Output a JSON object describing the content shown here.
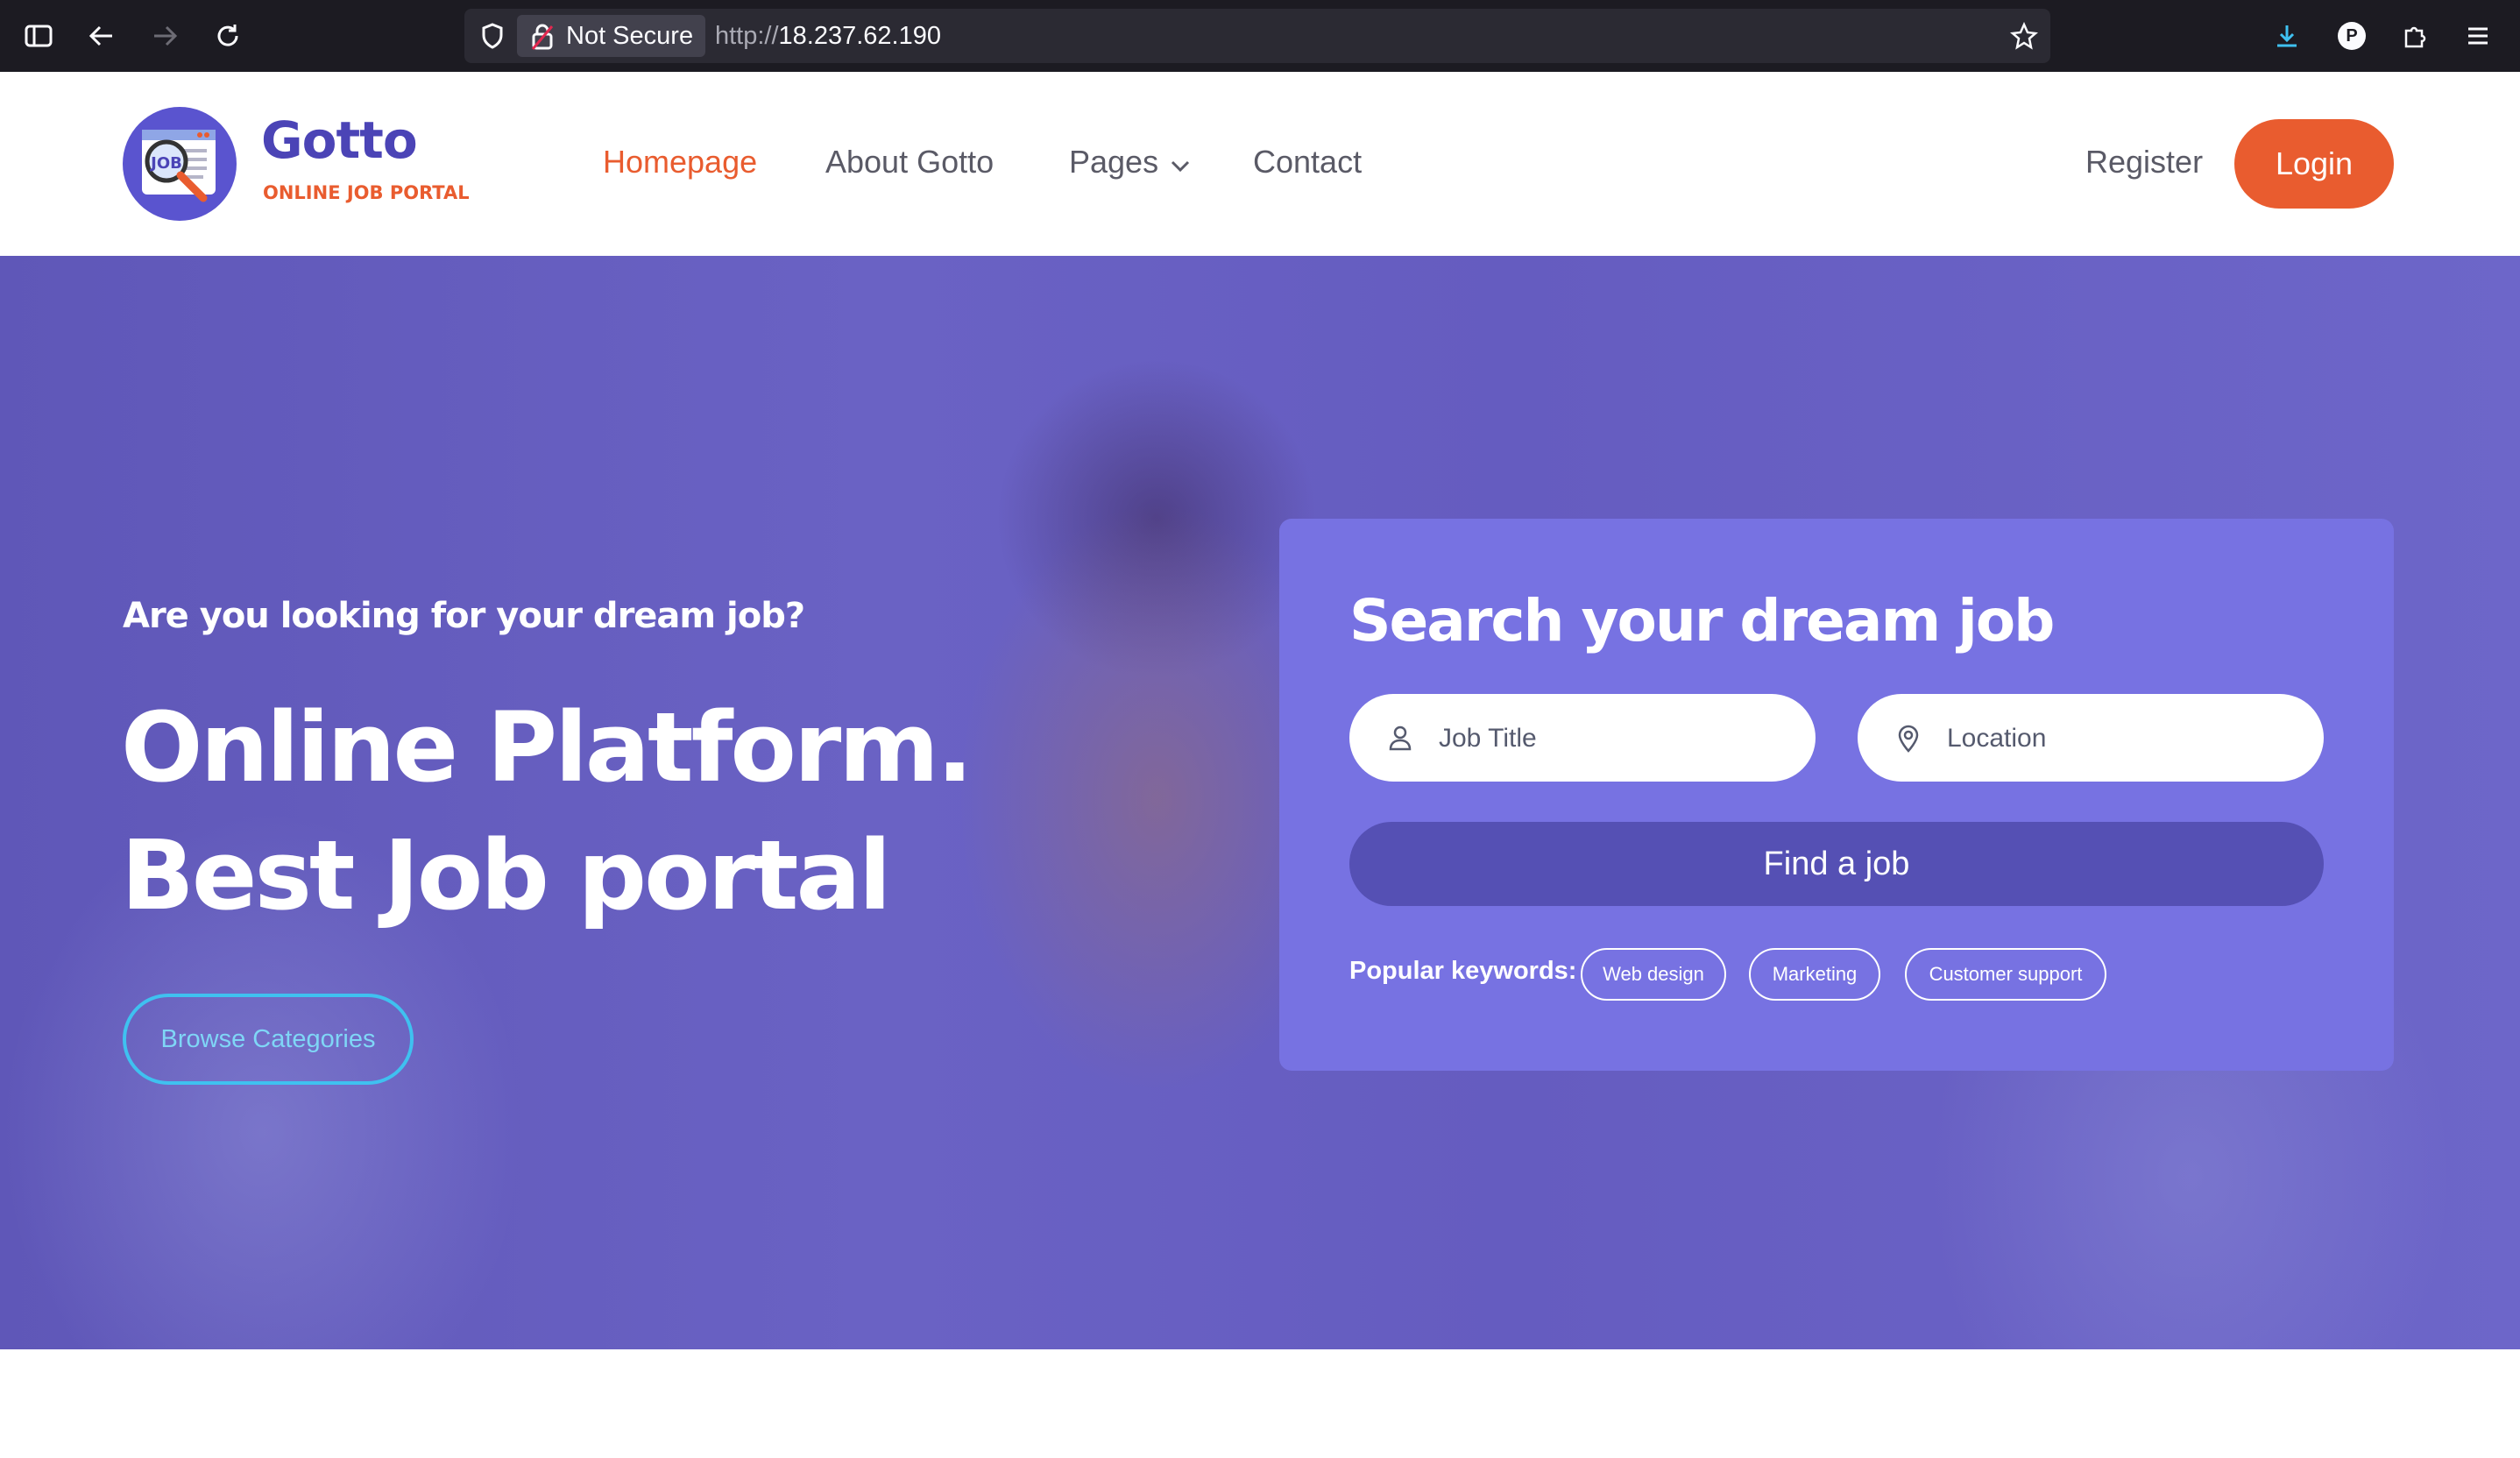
{
  "browser": {
    "security_label": "Not Secure",
    "url_protocol": "http://",
    "url_host": "18.237.62.190",
    "profile_initial": "P"
  },
  "header": {
    "brand_name": "Gotto",
    "brand_tagline": "ONLINE JOB PORTAL",
    "logo_text": "JOB",
    "nav": [
      {
        "label": "Homepage",
        "active": true
      },
      {
        "label": "About Gotto"
      },
      {
        "label": "Pages"
      },
      {
        "label": "Contact"
      }
    ],
    "register_label": "Register",
    "login_label": "Login"
  },
  "hero": {
    "subtitle": "Are you looking for your dream job?",
    "title_line1": "Online Platform.",
    "title_line2": "Best Job portal",
    "browse_label": "Browse Categories"
  },
  "search": {
    "title": "Search your dream job",
    "job_title_placeholder": "Job Title",
    "location_placeholder": "Location",
    "submit_label": "Find a job",
    "keywords_label": "Popular keywords:",
    "keywords": [
      "Web design",
      "Marketing",
      "Customer support"
    ]
  },
  "colors": {
    "accent": "#e95c2f",
    "brand": "#4b44b6",
    "panel": "#7772e2",
    "button": "#5550b4"
  }
}
